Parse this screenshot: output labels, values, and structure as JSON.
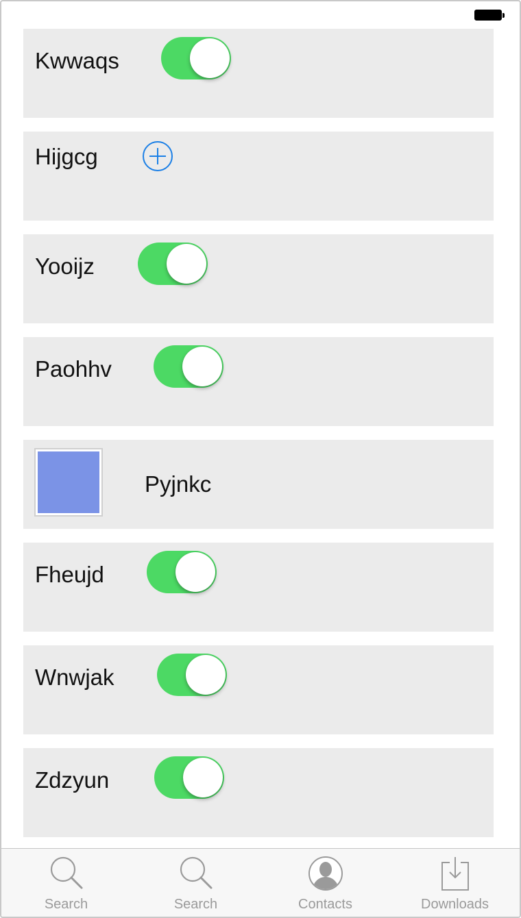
{
  "status_bar": {
    "battery_icon": "battery-full-icon"
  },
  "rows": [
    {
      "label": "Kwwaqs",
      "control": "toggle",
      "on": true
    },
    {
      "label": "Hijgcg",
      "control": "add-button",
      "icon": "plus-circle-icon"
    },
    {
      "label": "Yooijz",
      "control": "toggle",
      "on": true
    },
    {
      "label": "Paohhv",
      "control": "toggle",
      "on": true
    },
    {
      "label": "Pyjnkc",
      "control": "image",
      "image_color": "#7b93e6"
    },
    {
      "label": "Fheujd",
      "control": "toggle",
      "on": true
    },
    {
      "label": "Wnwjak",
      "control": "toggle",
      "on": true
    },
    {
      "label": "Zdzyun",
      "control": "toggle",
      "on": true
    }
  ],
  "tab_bar": {
    "tabs": [
      {
        "label": "Search",
        "icon": "search-icon"
      },
      {
        "label": "Search",
        "icon": "search-icon"
      },
      {
        "label": "Contacts",
        "icon": "contact-icon"
      },
      {
        "label": "Downloads",
        "icon": "download-icon"
      }
    ]
  },
  "colors": {
    "toggle_on": "#4cd964",
    "row_background": "#ebebeb",
    "add_button": "#1a7fe6",
    "tab_inactive": "#9a9a9a"
  }
}
